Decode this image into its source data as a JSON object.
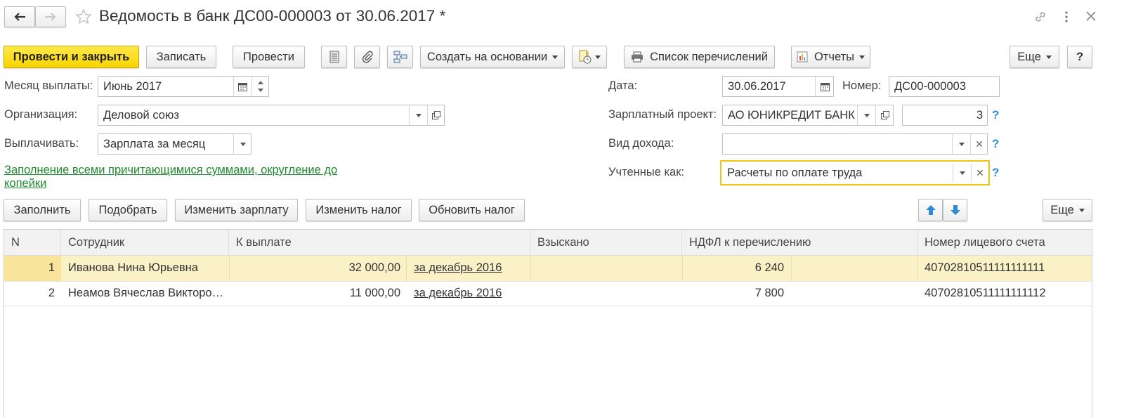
{
  "window": {
    "title": "Ведомость в банк ДС00-000003 от 30.06.2017 *",
    "colors": {
      "primary": "#f8d400",
      "link": "#1f8a2e",
      "help": "#2b8fd9",
      "selected_row": "#fbf1c6",
      "focus": "#f1c40f"
    }
  },
  "toolbar": {
    "post_close": "Провести и закрыть",
    "save": "Записать",
    "post": "Провести",
    "create_based": "Создать на основании",
    "transfer_list": "Список перечислений",
    "reports": "Отчеты",
    "more": "Еще",
    "help": "?"
  },
  "form": {
    "month_label": "Месяц выплаты:",
    "month_value": "Июнь 2017",
    "org_label": "Организация:",
    "org_value": "Деловой союз",
    "pay_label": "Выплачивать:",
    "pay_value": "Зарплата за месяц",
    "fill_link": "Заполнение всеми причитающимися суммами, округление до копейки",
    "date_label": "Дата:",
    "date_value": "30.06.2017",
    "number_label": "Номер:",
    "number_value": "ДС00-000003",
    "project_label": "Зарплатный проект:",
    "project_value": "АО ЮНИКРЕДИТ БАНК",
    "project_count": "3",
    "income_label": "Вид дохода:",
    "income_value": "",
    "accounted_label": "Учтенные как:",
    "accounted_value": "Расчеты по оплате труда",
    "help_mark": "?"
  },
  "table_toolbar": {
    "fill": "Заполнить",
    "pick": "Подобрать",
    "change_salary": "Изменить зарплату",
    "change_tax": "Изменить налог",
    "update_tax": "Обновить налог",
    "more": "Еще"
  },
  "table": {
    "columns": [
      "N",
      "Сотрудник",
      "К выплате",
      "Взыскано",
      "НДФЛ к перечислению",
      "Номер лицевого счета"
    ],
    "rows": [
      {
        "n": "1",
        "employee": "Иванова Нина Юрьевна",
        "amount": "32 000,00",
        "period": "за декабрь 2016",
        "withheld": "",
        "tax": "6 240",
        "account": "40702810511111111111"
      },
      {
        "n": "2",
        "employee": "Неамов Вячеслав Викторо…",
        "amount": "11 000,00",
        "period": "за декабрь 2016",
        "withheld": "",
        "tax": "7 800",
        "account": "40702810511111111112"
      }
    ]
  },
  "icons": [
    "back-arrow-icon",
    "forward-arrow-icon",
    "star-icon",
    "link-icon",
    "kebab-menu-icon",
    "close-icon",
    "calendar-icon",
    "spin-up-icon",
    "spin-down-icon",
    "dropdown-icon",
    "open-icon",
    "clear-icon",
    "list-icon",
    "paperclip-icon",
    "structure-icon",
    "doc-clock-icon",
    "printer-icon",
    "report-icon",
    "arrow-up-icon",
    "arrow-down-icon"
  ]
}
